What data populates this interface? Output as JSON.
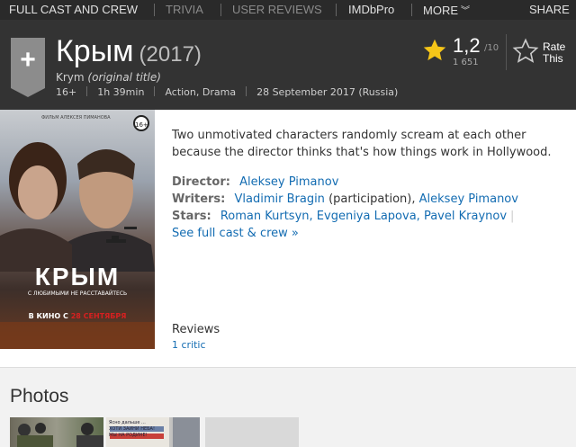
{
  "topnav": {
    "items": [
      "FULL CAST AND CREW",
      "TRIVIA",
      "USER REVIEWS",
      "IMDbPro",
      "MORE"
    ],
    "share": "SHARE"
  },
  "title": {
    "main": "Крым",
    "year": "(2017)",
    "original_name": "Krym",
    "original_label": "(original title)",
    "meta": [
      "16+",
      "1h 39min",
      "Action, Drama",
      "28 September 2017 (Russia)"
    ]
  },
  "rating": {
    "value": "1,2",
    "best": "/10",
    "count": "1 651",
    "rate_line1": "Rate",
    "rate_line2": "This",
    "star_color": "#f5c518"
  },
  "poster": {
    "credit": "ФИЛЬМ АЛЕКСЕЯ ПИМАНОВА",
    "age": "16+",
    "name": "КРЫМ",
    "tagline": "С ЛЮБИМЫМИ НЕ РАССТАВАЙТЕСЬ",
    "release_prefix": "В КИНО С",
    "release_date": "28 СЕНТЯБРЯ"
  },
  "summary": "Two unmotivated characters randomly scream at each other because the director thinks that's how things work in Hollywood.",
  "credits": {
    "director_label": "Director:",
    "director": "Aleksey Pimanov",
    "writers_label": "Writers:",
    "writer1": "Vladimir Bragin",
    "writer1_note": "(participation),",
    "writer2": "Aleksey Pimanov",
    "stars_label": "Stars:",
    "star1": "Roman Kurtsyn,",
    "star2": "Evgeniya Lapova,",
    "star3": "Pavel Kraynov",
    "full_cast": "See full cast & crew »"
  },
  "reviews": {
    "label": "Reviews",
    "count": "1 critic"
  },
  "photos": {
    "heading": "Photos",
    "thumb2_text": "Ясно дальше ...\nХОТИ ЗАИНИ НЕБА!\nМЫ НА РОДИНЕ!"
  },
  "colors": {
    "link": "#136cb2",
    "header_bg": "#333333",
    "nav_bg": "#2a2a2a"
  }
}
